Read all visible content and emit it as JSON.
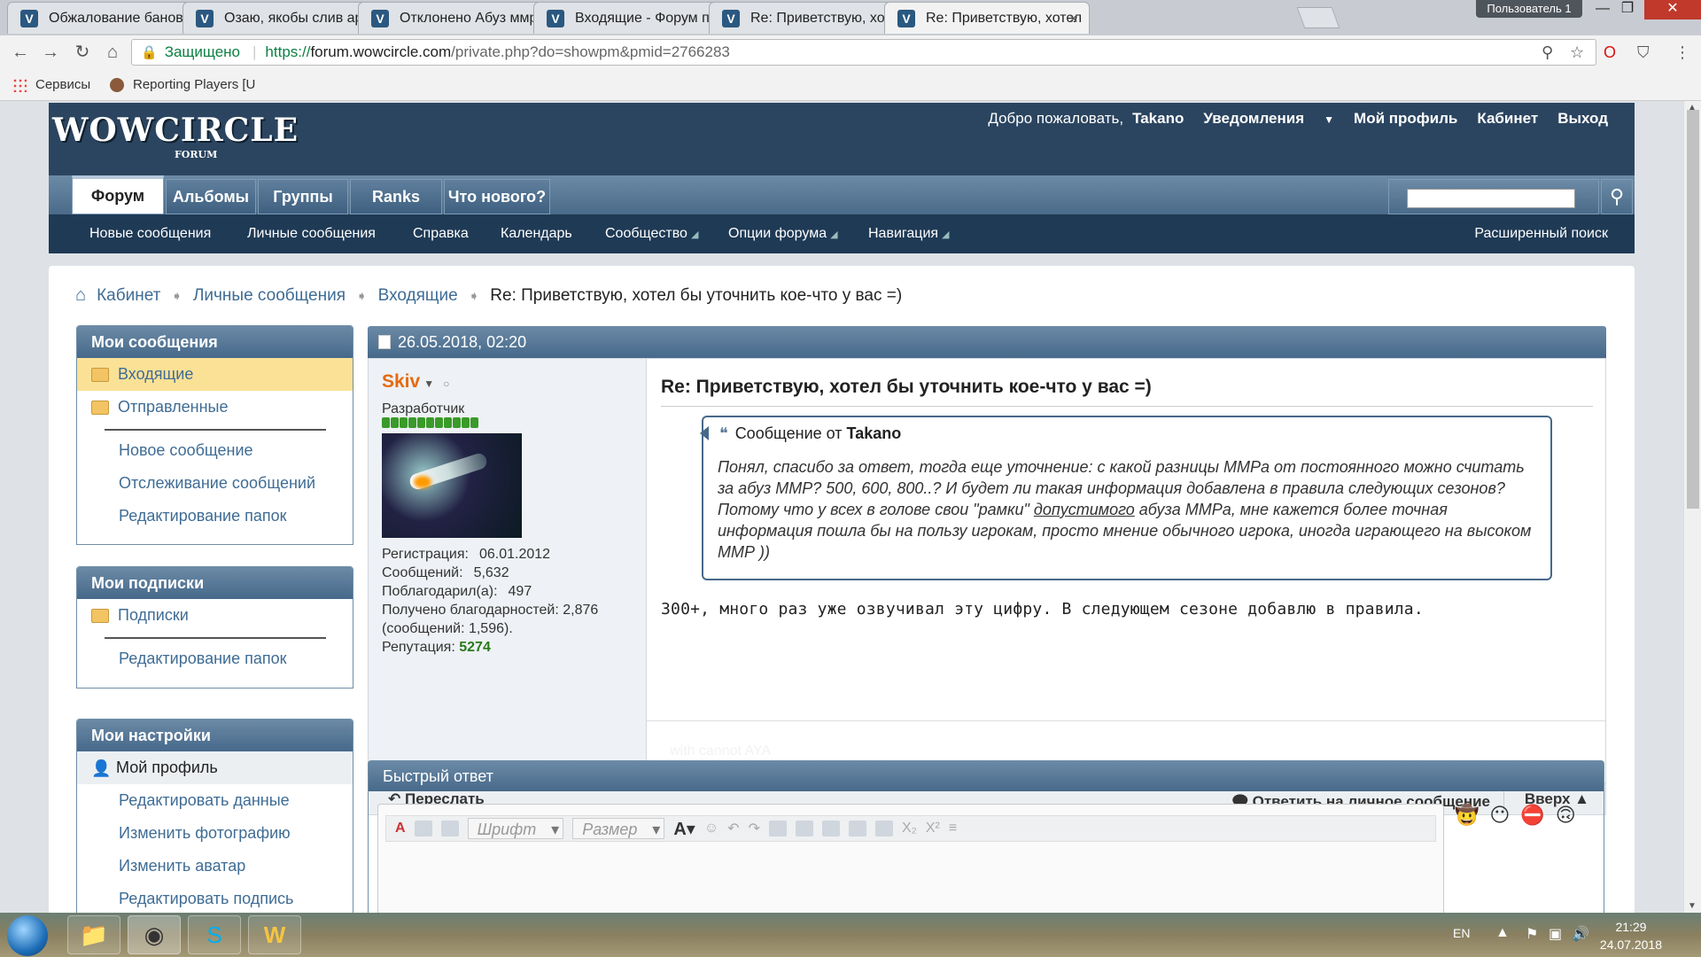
{
  "browser": {
    "tabs": [
      {
        "title": "Обжалование банов"
      },
      {
        "title": "Озаю, якобы слив арен"
      },
      {
        "title": "Отклонено Абуз ммра"
      },
      {
        "title": "Входящие - Форум прое"
      },
      {
        "title": "Re: Приветствую, хотел"
      },
      {
        "title": "Re: Приветствую, хотел"
      }
    ],
    "user_badge": "Пользователь 1",
    "secure_label": "Защищено",
    "url_proto": "https://",
    "url_host": "forum.wowcircle.com",
    "url_path": "/private.php?do=showpm&pmid=2766283",
    "bookmarks": [
      {
        "label": "Сервисы"
      },
      {
        "label": "Reporting Players [U"
      }
    ]
  },
  "header": {
    "logo": "WOWCIRCLE",
    "logo_sub": "FORUM",
    "welcome": "Добро пожаловать,",
    "username": "Takano",
    "notifications": "Уведомления",
    "profile": "Мой профиль",
    "cabinet": "Кабинет",
    "logout": "Выход"
  },
  "nav": {
    "tabs": [
      "Форум",
      "Альбомы",
      "Группы",
      "Ranks",
      "Что нового?"
    ],
    "subnav": [
      "Новые сообщения",
      "Личные сообщения",
      "Справка",
      "Календарь",
      "Сообщество",
      "Опции форума",
      "Навигация"
    ],
    "advanced_search": "Расширенный поиск"
  },
  "breadcrumb": {
    "items": [
      "Кабинет",
      "Личные сообщения",
      "Входящие"
    ],
    "current": "Re: Приветствую, хотел бы уточнить кое-что у вас =)"
  },
  "sidebar": {
    "messages": {
      "title": "Мои сообщения",
      "folders": [
        "Входящие",
        "Отправленные"
      ],
      "links": [
        "Новое сообщение",
        "Отслеживание сообщений",
        "Редактирование папок"
      ]
    },
    "subscriptions": {
      "title": "Мои подписки",
      "folders": [
        "Подписки"
      ],
      "links": [
        "Редактирование папок"
      ]
    },
    "settings": {
      "title": "Мои настройки",
      "profile": "Мой профиль",
      "links": [
        "Редактировать данные",
        "Изменить фотографию",
        "Изменить аватар",
        "Редактировать подпись"
      ]
    }
  },
  "post": {
    "date": "26.05.2018, 02:20",
    "author": "Skiv",
    "user_title": "Разработчик",
    "reputation_bars": 11,
    "stats": {
      "reg_label": "Регистрация:",
      "reg_value": "06.01.2012",
      "posts_label": "Сообщений:",
      "posts_value": "5,632",
      "thanked_label": "Поблагодарил(а):",
      "thanked_value": "497",
      "thanks_label": "Получено благодарностей:",
      "thanks_value": "2,876",
      "thanks_posts": "(сообщений: 1,596).",
      "rep_label": "Репутация:",
      "rep_value": "5274"
    },
    "title": "Re: Приветствую, хотел бы уточнить кое-что у вас =)",
    "quote_header_prefix": "Сообщение от",
    "quote_author": "Takano",
    "quote_text_1": "Понял, спасибо за ответ, тогда еще уточнение: с какой разницы ММРа от постоянного можно считать за абуз ММР? 500, 600, 800..? И будет ли такая информация добавлена в правила следующих сезонов? Потому что у всех в голове свои \"рамки\" ",
    "quote_text_underlined": "допустимого",
    "quote_text_2": " абуза ММРа, мне кажется более точная информация пошла бы на пользу игрокам, просто мнение обычного игрока, иногда играющего на высоком ММР ))",
    "reply_text": "300+, много раз уже озвучивал эту цифру. В следующем сезоне добавлю в правила.",
    "signature": "with cannot AYA",
    "forward": "Переслать",
    "reply_pm": "Ответить на личное сообщение",
    "top": "Вверх ▲"
  },
  "quick_reply": {
    "title": "Быстрый ответ",
    "font_placeholder": "Шрифт",
    "size_placeholder": "Размер"
  },
  "taskbar": {
    "lang": "EN",
    "time": "21:29",
    "date": "24.07.2018"
  },
  "colors": {
    "header_bg": "#2b4560",
    "accent": "#3f6c95",
    "author": "#e56a0f",
    "rep": "#2a7a1a"
  }
}
